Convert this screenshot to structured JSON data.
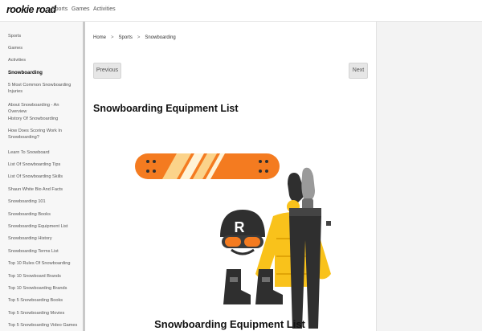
{
  "brand": {
    "logo": "rookie road"
  },
  "topnav": {
    "items": [
      "Sports",
      "Games",
      "Activities"
    ]
  },
  "sidebar": {
    "items": [
      "Sports",
      "Games",
      "Activities",
      "Snowboarding",
      "5 Most Common Snowboarding Injuries",
      "About Snowboarding - An Overview",
      "History Of Snowboarding",
      "How Does Scoring Work In Snowboarding?",
      "Learn To Snowboard",
      "List Of Snowboarding Tips",
      "List Of Snowboarding Skills",
      "Shaun White Bio And Facts",
      "Snowboarding 101",
      "Snowboarding Books",
      "Snowboarding Equipment List",
      "Snowboarding History",
      "Snowboarding Terms List",
      "Top 10 Rules Of Snowboarding",
      "Top 10 Snowboard Brands",
      "Top 10 Snowboarding Brands",
      "Top 5 Snowboarding Books",
      "Top 5 Snowboarding Movies",
      "Top 5 Snowboarding Video Games"
    ],
    "active": "Snowboarding"
  },
  "breadcrumb": {
    "items": [
      "Home",
      "Sports",
      "Snowboarding"
    ],
    "separator": ">"
  },
  "pager": {
    "previous": "Previous",
    "next": "Next"
  },
  "page": {
    "title": "Snowboarding Equipment List"
  },
  "illustration": {
    "caption": "Snowboarding Equipment List",
    "helmet_letter": "R"
  },
  "colors": {
    "accent_orange": "#f47b20",
    "jacket_yellow": "#f9c21b",
    "dark": "#2f2f2f",
    "sidebar_bg": "#f7f7f7"
  }
}
